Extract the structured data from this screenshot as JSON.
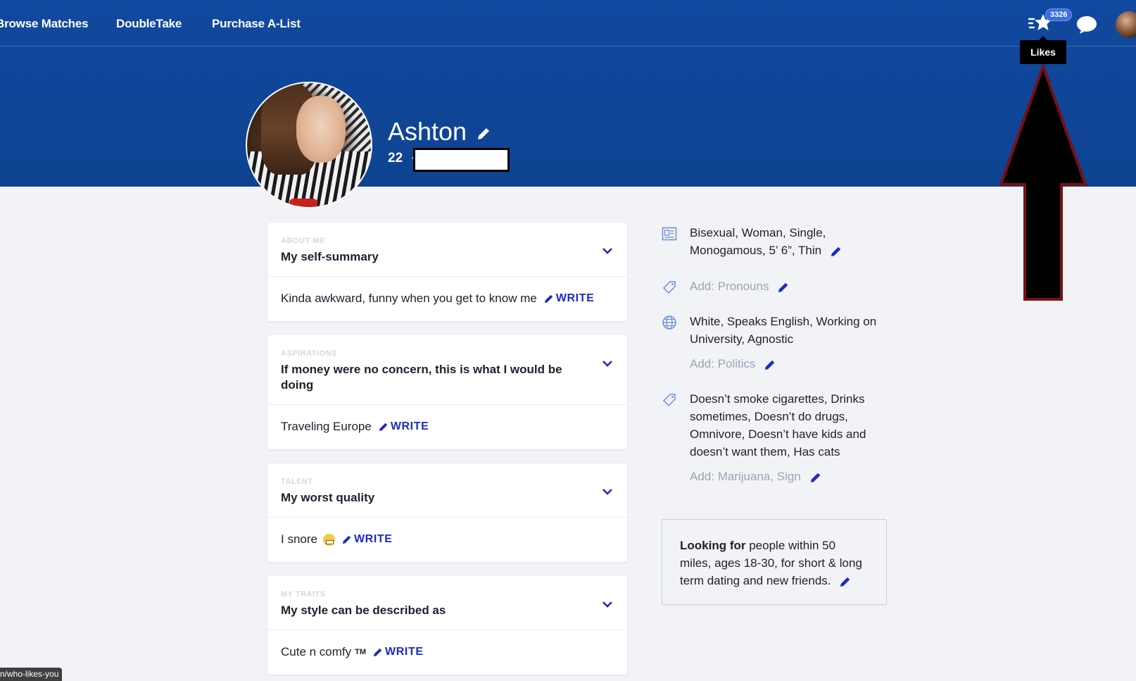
{
  "nav": {
    "browse_label": "Browse Matches",
    "doubletake_label": "DoubleTake",
    "alist_label": "Purchase A-List",
    "likes_count": "3326",
    "likes_tooltip": "Likes"
  },
  "profile": {
    "name": "Ashton",
    "age": "22",
    "separator": "·"
  },
  "essays": [
    {
      "category": "ABOUT ME",
      "title": "My self-summary",
      "answer": "Kinda awkward, funny when you get to know me",
      "write_label": "WRITE"
    },
    {
      "category": "ASPIRATIONS",
      "title": "If money were no concern, this is what I would be doing",
      "answer": "Traveling Europe",
      "write_label": "WRITE"
    },
    {
      "category": "TALENT",
      "title": "My worst quality",
      "answer": "I snore",
      "write_label": "WRITE"
    },
    {
      "category": "MY TRAITS",
      "title": "My style can be described as",
      "answer": "Cute n comfy",
      "answer_suffix": "TM",
      "write_label": "WRITE"
    }
  ],
  "details": {
    "basics": "Bisexual, Woman, Single, Monogamous, 5’ 6”, Thin",
    "pronouns_add": "Add: Pronouns",
    "background": "White, Speaks English, Working on University, Agnostic",
    "politics_add": "Add: Politics",
    "lifestyle": "Doesn’t smoke cigarettes, Drinks sometimes, Doesn’t do drugs, Omnivore, Doesn’t have kids and doesn’t want them, Has cats",
    "lifestyle_add": "Add: Marijuana, Sign"
  },
  "looking_for": {
    "label": "Looking for",
    "text": "people within 50 miles, ages 18-30, for short & long term dating and new friends."
  },
  "status_bar": {
    "url": "n/who-likes-you"
  },
  "colors": {
    "header_blue": "#114a9c",
    "link_blue": "#1d2bc2",
    "annotation_arrow_fill": "#000000",
    "annotation_arrow_border": "#7a0f14"
  }
}
